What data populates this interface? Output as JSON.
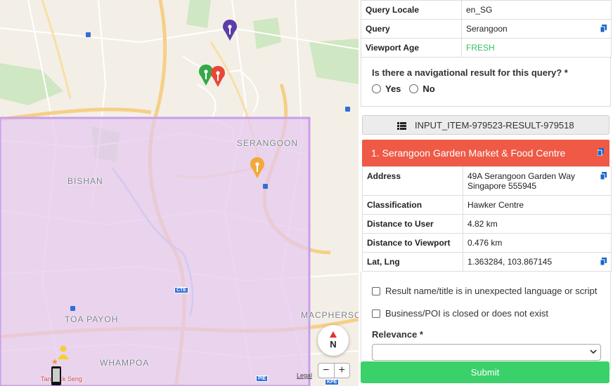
{
  "map": {
    "labels": {
      "serangoon": "SERANGOON",
      "bishan": "BISHAN",
      "toa_payoh": "TOA PAYOH",
      "whampoa": "WHAMPOA",
      "macpherson": "MACPHERSO",
      "tan_tock_seng": "Tan Tock Seng"
    },
    "shields": {
      "cte": "CTE",
      "pie": "PIE",
      "kpe": "KPE"
    },
    "compass_label": "N",
    "zoom_out": "−",
    "zoom_in": "+",
    "legal": "Legal",
    "colors": {
      "viewport_fill": "#e4c8f0",
      "pin_purple": "#5b3ea8",
      "pin_green": "#35a84a",
      "pin_red": "#e8483a",
      "pin_orange": "#f2a93b"
    }
  },
  "query_info": [
    {
      "key": "Query Locale",
      "value": "en_SG"
    },
    {
      "key": "Query",
      "value": "Serangoon"
    },
    {
      "key": "Viewport Age",
      "value": "FRESH"
    }
  ],
  "question": {
    "text": "Is there a navigational result for this query? *",
    "yes": "Yes",
    "no": "No"
  },
  "item_id": "INPUT_ITEM-979523-RESULT-979518",
  "result": {
    "title": "1. Serangoon Garden Market & Food Centre",
    "rows": [
      {
        "key": "Address",
        "value_line1": "49A Serangoon Garden Way",
        "value_line2": "Singapore 555945"
      },
      {
        "key": "Classification",
        "value": "Hawker Centre"
      },
      {
        "key": "Distance to User",
        "value": "4.82 km"
      },
      {
        "key": "Distance to Viewport",
        "value": "0.476 km"
      },
      {
        "key": "Lat, Lng",
        "value": "1.363284, 103.867145"
      }
    ]
  },
  "checks": {
    "language": "Result name/title is in unexpected language or script",
    "closed": "Business/POI is closed or does not exist"
  },
  "relevance_label": "Relevance *",
  "submit_label": "Submit"
}
